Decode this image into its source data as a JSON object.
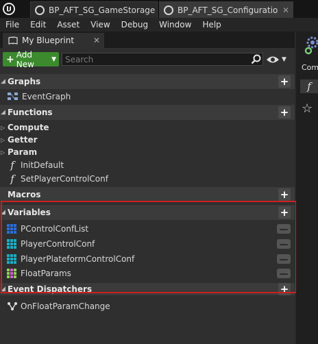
{
  "tabs": [
    {
      "label": "BP_AFT_SG_GameStorage",
      "active": false
    },
    {
      "label": "BP_AFT_SG_Configuration",
      "active": true
    }
  ],
  "menu": [
    "File",
    "Edit",
    "Asset",
    "View",
    "Debug",
    "Window",
    "Help"
  ],
  "panel": {
    "tab_label": "My Blueprint",
    "add_new_label": "Add New",
    "search_placeholder": "Search"
  },
  "sections": {
    "graphs": {
      "label": "Graphs",
      "items": [
        "EventGraph"
      ]
    },
    "functions": {
      "label": "Functions",
      "categories": [
        "Compute",
        "Getter",
        "Param"
      ],
      "items": [
        "InitDefault",
        "SetPlayerControlConf"
      ]
    },
    "macros": {
      "label": "Macros"
    },
    "variables": {
      "label": "Variables",
      "items": [
        {
          "name": "PControlConfList",
          "color": "#2a6fdc"
        },
        {
          "name": "PlayerControlConf",
          "color": "#1ab0c8"
        },
        {
          "name": "PlayerPlateformControlConf",
          "color": "#1ab0c8"
        },
        {
          "name": "FloatParams",
          "color": "#8bd84a"
        }
      ]
    },
    "event_dispatchers": {
      "label": "Event Dispatchers",
      "items": [
        "OnFloatParamChange"
      ]
    }
  },
  "right_panel": {
    "label": "Com"
  },
  "colors": {
    "add_new": "#3c8a2e",
    "highlight": "#d11f1f"
  }
}
